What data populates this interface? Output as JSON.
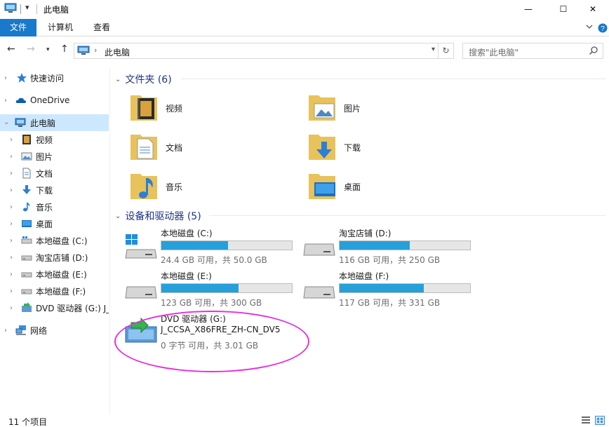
{
  "window": {
    "title": "此电脑",
    "minimize": "—",
    "maximize": "☐",
    "close": "✕"
  },
  "ribbon": {
    "tabs": [
      "文件",
      "计算机",
      "查看"
    ],
    "collapse_icon": "chevron-down-icon",
    "help_icon": "help-icon"
  },
  "address": {
    "path": "此电脑",
    "search_placeholder": "搜索\"此电脑\""
  },
  "sidebar": {
    "items": [
      {
        "label": "快速访问",
        "icon": "star-icon"
      },
      {
        "label": "OneDrive",
        "icon": "cloud-icon"
      },
      {
        "label": "此电脑",
        "icon": "computer-icon",
        "selected": true
      },
      {
        "label": "视频",
        "icon": "video-icon"
      },
      {
        "label": "图片",
        "icon": "pictures-icon"
      },
      {
        "label": "文档",
        "icon": "document-icon"
      },
      {
        "label": "下载",
        "icon": "download-icon"
      },
      {
        "label": "音乐",
        "icon": "music-icon"
      },
      {
        "label": "桌面",
        "icon": "desktop-icon"
      },
      {
        "label": "本地磁盘 (C:)",
        "icon": "drive-icon"
      },
      {
        "label": "淘宝店铺 (D:)",
        "icon": "drive-icon"
      },
      {
        "label": "本地磁盘 (E:)",
        "icon": "drive-icon"
      },
      {
        "label": "本地磁盘 (F:)",
        "icon": "drive-icon"
      },
      {
        "label": "DVD 驱动器 (G:) J_",
        "icon": "dvd-icon"
      },
      {
        "label": "网络",
        "icon": "network-icon"
      }
    ]
  },
  "folders_group": {
    "header": "文件夹 (6)",
    "items": [
      {
        "label": "视频",
        "icon": "video-folder-icon"
      },
      {
        "label": "图片",
        "icon": "pictures-folder-icon"
      },
      {
        "label": "文档",
        "icon": "documents-folder-icon"
      },
      {
        "label": "下载",
        "icon": "downloads-folder-icon"
      },
      {
        "label": "音乐",
        "icon": "music-folder-icon"
      },
      {
        "label": "桌面",
        "icon": "desktop-folder-icon"
      }
    ]
  },
  "drives_group": {
    "header": "设备和驱动器 (5)",
    "drives": [
      {
        "name": "本地磁盘 (C:)",
        "free": "24.4 GB 可用，共 50.0 GB",
        "used_fraction": 0.512
      },
      {
        "name": "淘宝店铺 (D:)",
        "free": "116 GB 可用，共 250 GB",
        "used_fraction": 0.536
      },
      {
        "name": "本地磁盘 (E:)",
        "free": "123 GB 可用，共 300 GB",
        "used_fraction": 0.59
      },
      {
        "name": "本地磁盘 (F:)",
        "free": "117 GB 可用，共 331 GB",
        "used_fraction": 0.647
      }
    ],
    "dvd": {
      "name": "DVD 驱动器 (G:)",
      "label": "J_CCSA_X86FRE_ZH-CN_DV5",
      "free": "0 字节 可用，共 3.01 GB"
    }
  },
  "status": {
    "count": "11 个项目"
  },
  "colors": {
    "accent": "#1979ca",
    "bar_fill": "#26a0da",
    "highlight": "#e330e0",
    "selected_bg": "#cce8ff"
  }
}
